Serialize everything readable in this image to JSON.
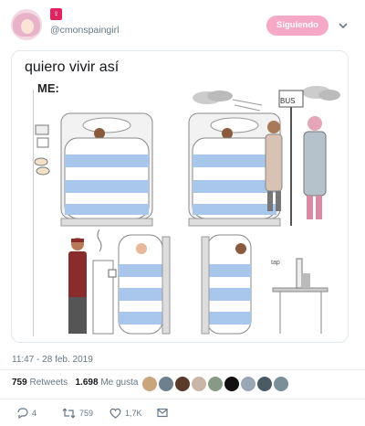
{
  "header": {
    "handle": "@cmonspaingirl",
    "follow_label": "Siguiendo",
    "avatar_icon": "user-avatar",
    "badge_icon": "venus-icon",
    "menu_icon": "chevron-down-icon"
  },
  "tweet": {
    "text": "quiero vivir así",
    "comic_label": "ME:",
    "sign_text": "BUS",
    "tap_text": "tap",
    "timestamp": "11:47 - 28 feb. 2019"
  },
  "stats": {
    "retweets_count": "759",
    "retweets_label": "Retweets",
    "likes_count": "1.698",
    "likes_label": "Me gusta"
  },
  "actions": {
    "replies": "4",
    "retweets": "759",
    "likes": "1,7K"
  },
  "colors": {
    "accent": "#e0245e",
    "follow_bg": "#f6a9c7",
    "muted": "#657786",
    "blanket_stripe": "#a9c7ec"
  }
}
